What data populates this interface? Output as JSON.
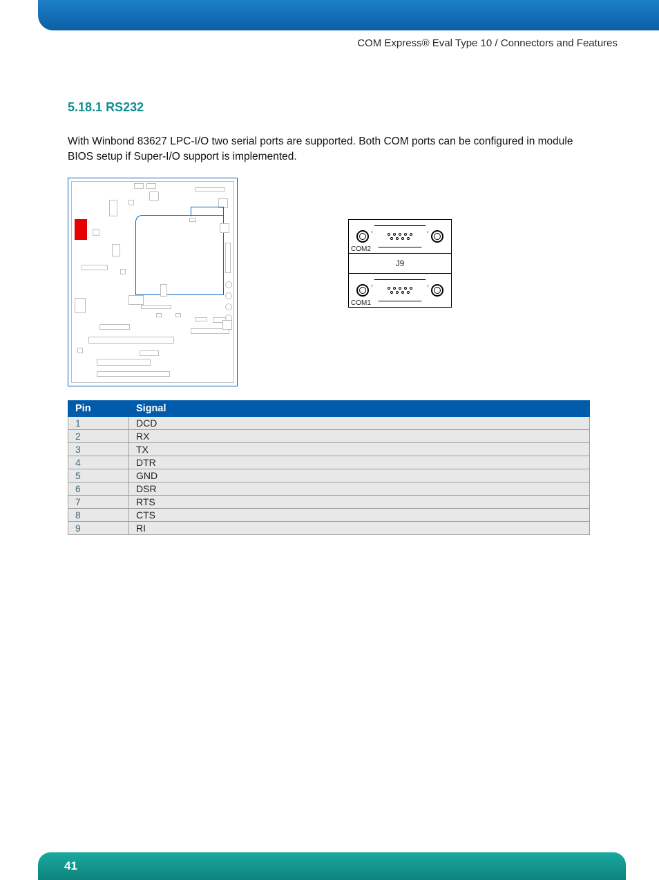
{
  "header": {
    "breadcrumb": "COM Express® Eval Type 10 / Connectors and Features"
  },
  "section": {
    "number": "5.18.1",
    "title": "RS232",
    "body": "With Winbond 83627 LPC-I/O two serial ports are supported. Both COM ports can be configured in module BIOS setup if Super-I/O support is implemented."
  },
  "connector": {
    "top_label": "COM2",
    "mid_label": "J9",
    "bottom_label": "COM1"
  },
  "table": {
    "headers": {
      "pin": "Pin",
      "signal": "Signal"
    },
    "rows": [
      {
        "pin": "1",
        "signal": "DCD"
      },
      {
        "pin": "2",
        "signal": "RX"
      },
      {
        "pin": "3",
        "signal": "TX"
      },
      {
        "pin": "4",
        "signal": "DTR"
      },
      {
        "pin": "5",
        "signal": "GND"
      },
      {
        "pin": "6",
        "signal": "DSR"
      },
      {
        "pin": "7",
        "signal": "RTS"
      },
      {
        "pin": "8",
        "signal": "CTS"
      },
      {
        "pin": "9",
        "signal": "RI"
      }
    ]
  },
  "footer": {
    "page": "41"
  }
}
